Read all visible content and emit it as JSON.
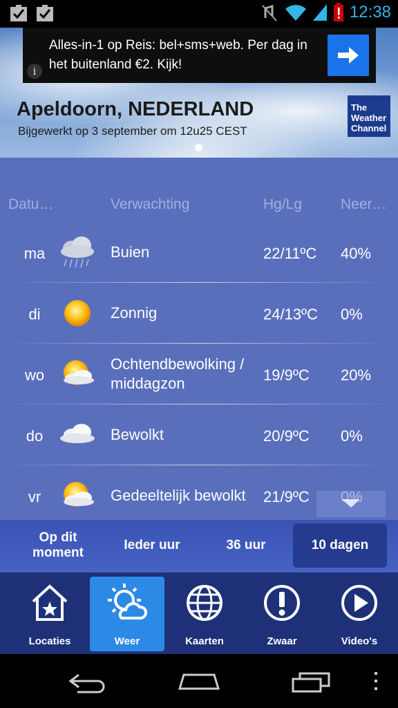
{
  "status_bar": {
    "time": "12:38"
  },
  "ad": {
    "text": "Alles-in-1 op Reis: bel+sms+web. Per dag in het buitenland €2. Kijk!",
    "info": "i"
  },
  "location": {
    "city": "Apeldoorn, NEDERLAND",
    "updated": "Bijgewerkt op 3 september om 12u25 CEST"
  },
  "brand": {
    "line1": "The",
    "line2": "Weather",
    "line3": "Channel"
  },
  "table": {
    "headers": {
      "date": "Datu…",
      "forecast": "Verwachting",
      "temp": "Hg/Lg",
      "precip": "Neer…"
    },
    "rows": [
      {
        "day": "ma",
        "icon": "rain-cloud-icon",
        "forecast": "Buien",
        "temp": "22/11ºC",
        "precip": "40%"
      },
      {
        "day": "di",
        "icon": "sun-icon",
        "forecast": "Zonnig",
        "temp": "24/13ºC",
        "precip": "0%"
      },
      {
        "day": "wo",
        "icon": "sun-behind-cloud-icon",
        "forecast": "Ochtendbewolking / middagzon",
        "temp": "19/9ºC",
        "precip": "20%"
      },
      {
        "day": "do",
        "icon": "cloud-icon",
        "forecast": "Bewolkt",
        "temp": "20/9ºC",
        "precip": "0%"
      },
      {
        "day": "vr",
        "icon": "sun-behind-cloud-icon",
        "forecast": "Gedeeltelijk bewolkt",
        "temp": "21/9ºC",
        "precip": "0%"
      }
    ]
  },
  "tabs": [
    {
      "label": "Op dit moment",
      "active": false
    },
    {
      "label": "Ieder uur",
      "active": false
    },
    {
      "label": "36 uur",
      "active": false
    },
    {
      "label": "10 dagen",
      "active": true
    }
  ],
  "nav": [
    {
      "label": "Locaties",
      "icon": "home-star-icon"
    },
    {
      "label": "Weer",
      "icon": "weather-icon",
      "active": true
    },
    {
      "label": "Kaarten",
      "icon": "globe-icon"
    },
    {
      "label": "Zwaar",
      "icon": "alert-icon"
    },
    {
      "label": "Video's",
      "icon": "play-icon"
    }
  ],
  "colors": {
    "panel": "#5a6fbc",
    "tabs": "#4662c4",
    "nav": "#1d3078",
    "active_nav": "#2c8ae6",
    "status_accent": "#33b5e5"
  }
}
